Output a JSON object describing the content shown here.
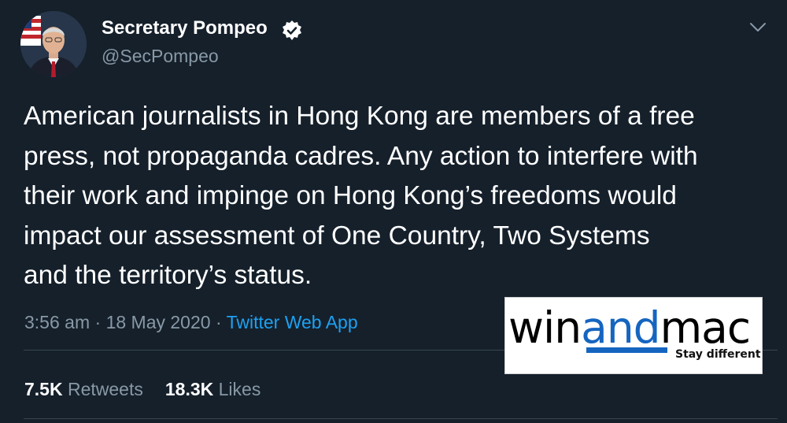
{
  "author": {
    "display_name": "Secretary Pompeo",
    "handle": "@SecPompeo",
    "verified": true,
    "avatar_icon": "profile-photo-with-us-flag"
  },
  "tweet": {
    "text_lines": [
      "American journalists in Hong Kong are members of a free",
      "press, not propaganda cadres. Any action to interfere with",
      "their work and impinge on Hong Kong’s freedoms would",
      "impact our assessment of One Country, Two Systems",
      "and the territory’s status."
    ],
    "time": "3:56 am",
    "separator": "·",
    "date": "18 May 2020",
    "source": "Twitter Web App"
  },
  "stats": {
    "retweets_count": "7.5K",
    "retweets_label": "Retweets",
    "likes_count": "18.3K",
    "likes_label": "Likes"
  },
  "watermark": {
    "brand_part1": "win",
    "brand_part2": "and",
    "brand_part3": "mac",
    "tagline": "Stay different"
  },
  "colors": {
    "background": "#15202b",
    "secondary_text": "#8899a6",
    "link": "#1da1f2",
    "watermark_accent": "#1565c0"
  }
}
